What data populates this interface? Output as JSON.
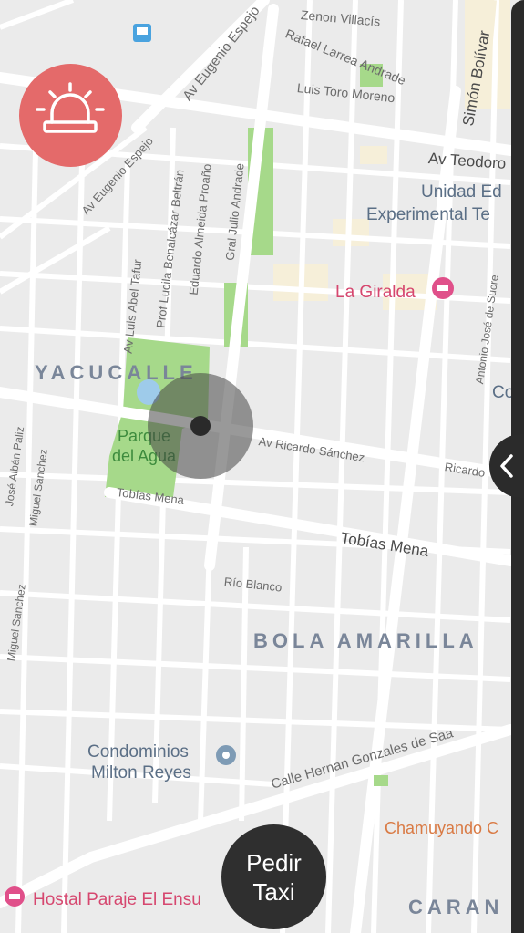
{
  "map": {
    "district_labels": [
      "YACUCALLE",
      "BOLA AMARILLA",
      "CARAN"
    ],
    "park_name": "Parque del Agua",
    "streets": {
      "av_eugenio_espejo_top": "Av Eugenio Espejo",
      "av_eugenio_espejo_left": "Av Eugenio Espejo",
      "zenon_villacis": "Zenon Villacís",
      "rafael_larrea": "Rafael Larrea Andrade",
      "luis_toro": "Luis Toro Moreno",
      "simon_bolivar": "Simón Bolívar",
      "av_teodoro": "Av Teodoro",
      "beltran": "Prof Lucila Benalcázar Beltrán",
      "proano": "Eduardo Almeida Proaño",
      "andrade": "Gral Julio Andrade",
      "tafur": "Av Luis Abel Tafur",
      "ricardo_sanchez": "Av Ricardo Sánchez",
      "ricardo_right": "Ricardo",
      "tobias_mena_left": "Tobías Mena",
      "tobias_mena_right": "Tobías Mena",
      "rio_blanco": "Río Blanco",
      "miguel_sanchez_top": "Miguel Sanchez",
      "miguel_sanchez_bottom": "Miguel Sanchez",
      "alban_paliz": "José Albán Paliz",
      "antonio_sucre": "Antonio José de Sucre",
      "hernan_gonzales": "Calle Hernan Gonzales de Saa"
    },
    "pois": {
      "unidad_line1": "Unidad Ed",
      "unidad_line2": "Experimental Te",
      "la_giralda": "La Giralda",
      "condominios_line1": "Condominios",
      "condominios_line2": "Milton Reyes",
      "chamuyando": "Chamuyando C",
      "hostal": "Hostal Paraje El Ensu",
      "co": "Co"
    }
  },
  "controls": {
    "alarm_icon": "alarm-siren-icon",
    "collapse_icon": "chevron-left-icon",
    "taxi_line1": "Pedir",
    "taxi_line2": "Taxi"
  },
  "colors": {
    "alarm": "#e46a6a",
    "taxi_button": "#2f2f2f",
    "park": "#a6d98a",
    "hotel_pink": "#e0508a"
  }
}
